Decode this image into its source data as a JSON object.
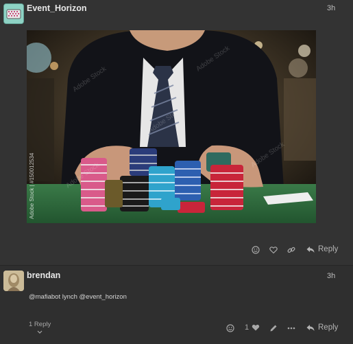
{
  "posts": [
    {
      "username": "Event_Horizon",
      "time": "3h",
      "image": {
        "watermark": "Adobe Stock",
        "stock_id": "Adobe Stock | #150012534"
      },
      "actions": {
        "reply": "Reply"
      }
    },
    {
      "username": "brendan",
      "time": "3h",
      "text": "@mafiabot  lynch  @event_horizon",
      "replies": "1 Reply",
      "like_count": "1",
      "actions": {
        "reply": "Reply"
      }
    }
  ],
  "colors": {
    "background": "#333333",
    "accent_avatar": "#8ed2c4",
    "table_green": "#2e6a3d",
    "chip_red": "#c8253a",
    "chip_blue": "#2d5fb0",
    "chip_cyan": "#2fa3cc",
    "chip_pink": "#d95a8a"
  }
}
